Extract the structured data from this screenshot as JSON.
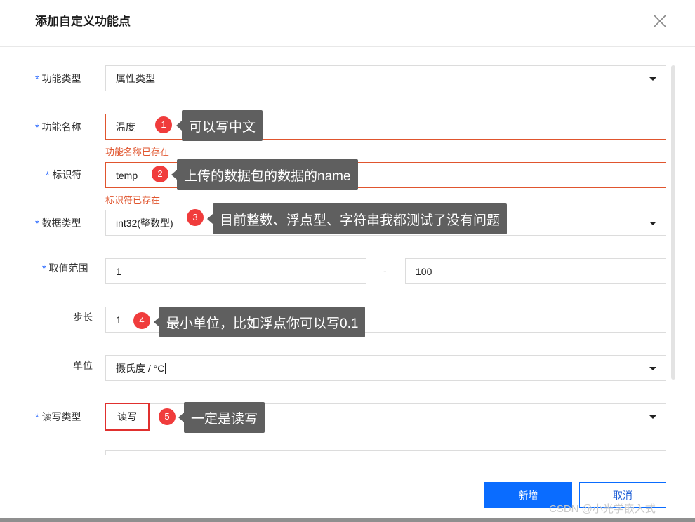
{
  "dialog": {
    "title": "添加自定义功能点",
    "close_icon": "close-icon"
  },
  "form": {
    "required_mark": "*",
    "function_type": {
      "label": "功能类型",
      "value": "属性类型"
    },
    "function_name": {
      "label": "功能名称",
      "value": "温度",
      "error": "功能名称已存在"
    },
    "identifier": {
      "label": "标识符",
      "value": "temp",
      "error": "标识符已存在"
    },
    "data_type": {
      "label": "数据类型",
      "value": "int32(整数型)"
    },
    "value_range": {
      "label": "取值范围",
      "min": "1",
      "separator": "-",
      "max": "100"
    },
    "step": {
      "label": "步长",
      "value": "1"
    },
    "unit": {
      "label": "单位",
      "value": "摄氏度 / °C"
    },
    "rw_type": {
      "label": "读写类型",
      "value": "读写"
    }
  },
  "annotations": [
    {
      "number": "1",
      "text": "可以写中文"
    },
    {
      "number": "2",
      "text": "上传的数据包的数据的name"
    },
    {
      "number": "3",
      "text": "目前整数、浮点型、字符串我都测试了没有问题"
    },
    {
      "number": "4",
      "text": "最小单位，比如浮点你可以写0.1"
    },
    {
      "number": "5",
      "text": "一定是读写"
    }
  ],
  "footer": {
    "confirm_label": "新增",
    "cancel_label": "取消"
  },
  "watermark": "CSDN @小光学嵌入式",
  "colors": {
    "primary": "#0a6cff",
    "error": "#e0552e",
    "required": "#2d6bff",
    "badge": "#f03c3c",
    "tooltip": "#5f5f5f"
  }
}
